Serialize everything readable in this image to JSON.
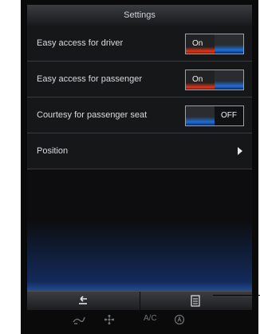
{
  "header": {
    "title": "Settings"
  },
  "rows": [
    {
      "label": "Easy access for driver",
      "control": "toggle",
      "state": "On"
    },
    {
      "label": "Easy access for passenger",
      "control": "toggle",
      "state": "On"
    },
    {
      "label": "Courtesy for passenger seat",
      "control": "toggle",
      "state": "OFF"
    },
    {
      "label": "Position",
      "control": "submenu"
    }
  ],
  "bottom_bar": {
    "back_icon": "back-arrow-icon",
    "menu_icon": "list-menu-icon"
  },
  "climate_bar": {
    "ac_label": "A/C",
    "icons": [
      "airflow-icon",
      "fan-icon",
      "auto-icon"
    ]
  },
  "colors": {
    "on_accent": "#e33516",
    "off_accent": "#1f6fd6",
    "background": "#0d0d0f"
  }
}
